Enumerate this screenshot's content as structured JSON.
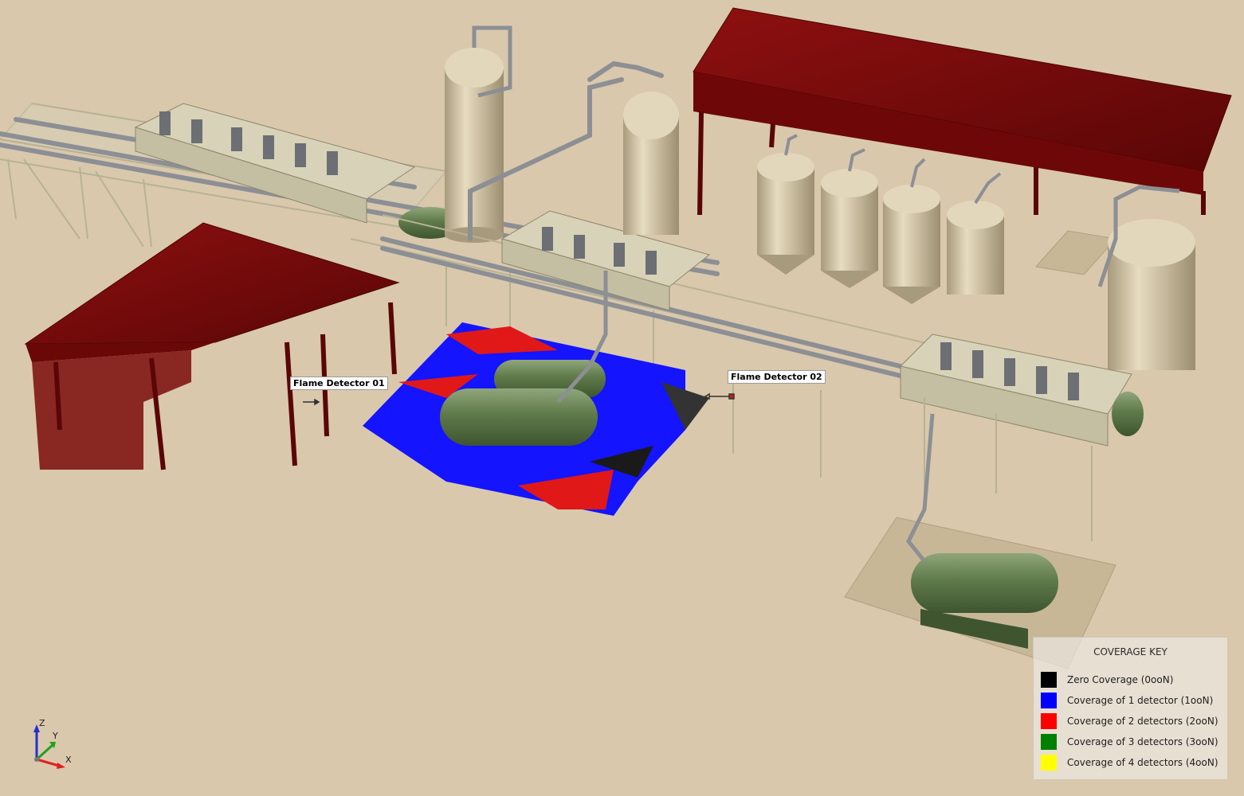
{
  "detectors": [
    {
      "label": "Flame Detector 01"
    },
    {
      "label": "Flame Detector 02"
    }
  ],
  "legend": {
    "title": "COVERAGE KEY",
    "items": [
      {
        "label": "Zero Coverage (0ooN)",
        "color": "#000000"
      },
      {
        "label": "Coverage of 1 detector (1ooN)",
        "color": "#0000ff"
      },
      {
        "label": "Coverage of 2 detectors (2ooN)",
        "color": "#ff0000"
      },
      {
        "label": "Coverage of 3 detectors (3ooN)",
        "color": "#008000"
      },
      {
        "label": "Coverage of 4 detectors (4ooN)",
        "color": "#ffff00"
      }
    ]
  },
  "axes": {
    "x": "X",
    "y": "Y",
    "z": "Z"
  },
  "colors": {
    "ground": "#d9c8ac",
    "roof": "#7a0a0a",
    "structure": "#d8d2b8",
    "vessel": "#5f7a4a",
    "tank": "#cfc0a0",
    "pipe": "#8c8f94"
  }
}
